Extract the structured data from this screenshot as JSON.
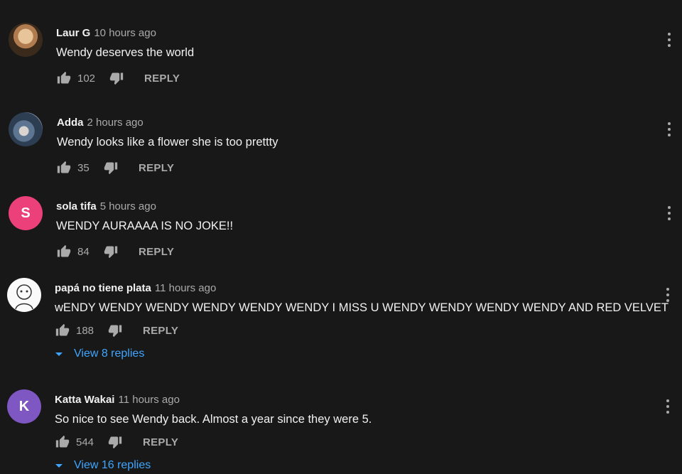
{
  "colors": {
    "background": "#181818",
    "text": "#f1f1f1",
    "secondary": "#aaaaaa",
    "link": "#3ea6ff"
  },
  "icons": {
    "like": "thumb-up-icon",
    "dislike": "thumb-down-icon",
    "more": "more-vert-icon",
    "expand": "caret-down-icon"
  },
  "reply_label": "REPLY",
  "comments": [
    {
      "author": "Laur G",
      "time": "10 hours ago",
      "text": "Wendy deserves the world",
      "likes": "102"
    },
    {
      "author": "Adda",
      "time": "2 hours ago",
      "text": "Wendy looks like a flower she is too prettty",
      "likes": "35"
    },
    {
      "author": "sola tifa",
      "time": "5 hours ago",
      "text": "WENDY AURAAAA IS NO JOKE!!",
      "likes": "84",
      "avatar_letter": "S"
    },
    {
      "author": "papá no tiene plata",
      "time": "11 hours ago",
      "text": "wENDY WENDY WENDY WENDY WENDY WENDY I MISS U WENDY WENDY WENDY WENDY AND RED VELVET",
      "likes": "188",
      "replies_label": "View 8 replies"
    },
    {
      "author": "Katta Wakai",
      "time": "11 hours ago",
      "text": "So nice to see Wendy back. Almost a year since they were 5.",
      "likes": "544",
      "avatar_letter": "K",
      "replies_label": "View 16 replies"
    }
  ]
}
